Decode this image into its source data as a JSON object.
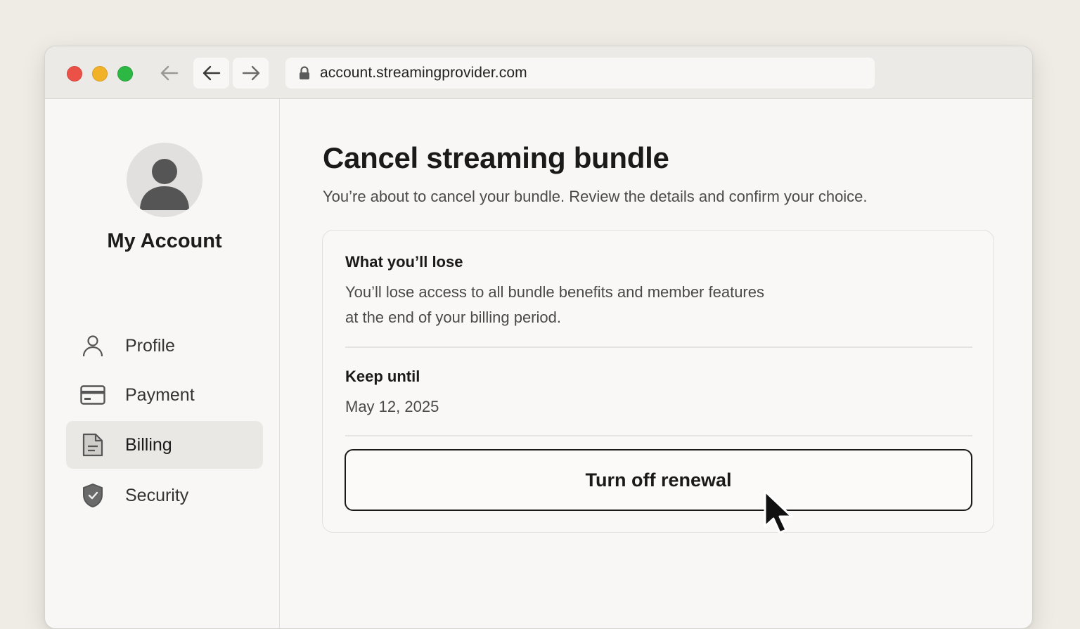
{
  "browser": {
    "url": "account.streamingprovider.com",
    "controls": {
      "close": "close",
      "minimize": "minimize",
      "maximize": "maximize"
    }
  },
  "sidebar": {
    "title": "My Account",
    "items": [
      {
        "label": "Profile",
        "icon": "person-icon",
        "active": false
      },
      {
        "label": "Payment",
        "icon": "credit-card-icon",
        "active": false
      },
      {
        "label": "Billing",
        "icon": "document-icon",
        "active": true
      },
      {
        "label": "Security",
        "icon": "shield-check-icon",
        "active": false
      }
    ]
  },
  "main": {
    "title": "Cancel streaming bundle",
    "subtitle": "You’re about to cancel your bundle. Review the details and confirm your choice.",
    "card": {
      "lose_heading": "What you’ll lose",
      "lose_line1": "You’ll lose access to all bundle benefits and member features",
      "lose_line2": "at the end of your billing period.",
      "keep_heading": "Keep until",
      "keep_date": "May 12, 2025",
      "cta_label": "Turn off renewal"
    }
  },
  "colors": {
    "background": "#efece5",
    "window": "#f8f7f5",
    "active_nav": "#e9e8e5",
    "traffic_red": "#ec5148",
    "traffic_yellow": "#f2b228",
    "traffic_green": "#2cb843"
  }
}
